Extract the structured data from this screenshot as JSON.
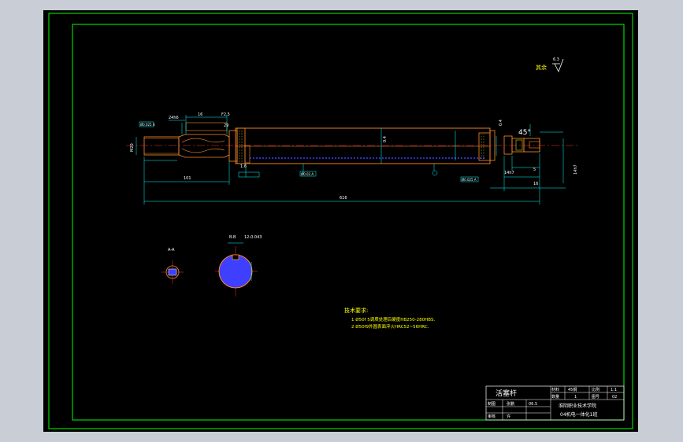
{
  "drawing": {
    "title": "活塞杆",
    "material_label": "材料",
    "material_value": "45钢",
    "quantity_label": "数量",
    "quantity_value": "1",
    "scale_label": "比例",
    "scale_value": "1:1",
    "drawing_no_label": "图号",
    "drawing_no_value": "02",
    "drawn_label": "制图",
    "drawn_value": "张鹏",
    "date_value": "06.5",
    "checked_label": "审核",
    "checked_value": "许",
    "school": "淮阴职业技术学院",
    "class_name": "04机电一体化1班"
  },
  "roughness": {
    "label": "其余",
    "value": "6.3"
  },
  "sections": {
    "a_label": "A-A",
    "b_label": "B-B",
    "b_dim": "12-0.043"
  },
  "dims": {
    "d1": "24h6",
    "d2": "16",
    "d3": "F2.5",
    "d4": "29",
    "d5": "45°",
    "total": "616",
    "left_len": "101",
    "left_dia": "M20",
    "width_a": "14h7",
    "width_b": "1.6",
    "right_a": "5",
    "right_b": "16",
    "right_c": "14h7",
    "tol_left": "Ø0.025 A",
    "tol_mid": "Ø0.03 A",
    "tol_right": "Ø0.025 A",
    "ra_mid": "0.4",
    "ra_right": "0.4"
  },
  "notes": {
    "heading": "技术要求:",
    "line1": "1  Ø50f 5调质处理后硬度HB250-280HBS.",
    "line2": "2  Ø50f9外圆表面淬火HRC52~56HRC."
  },
  "colors": {
    "background": "#000000",
    "outline": "#00ff00",
    "part": "#ff8c2a",
    "dimension": "#00ffff",
    "text": "#ffff00",
    "hatch": "#3f3fff",
    "center": "#ff3030",
    "white": "#ffffff"
  }
}
